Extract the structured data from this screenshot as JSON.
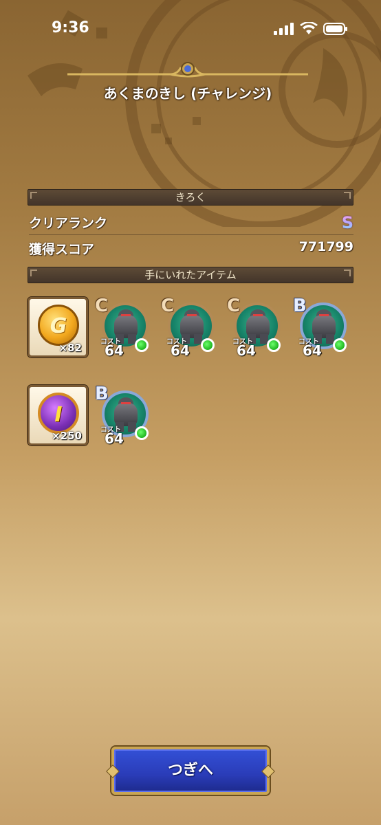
{
  "status_bar": {
    "time": "9:36"
  },
  "header": {
    "title": "あくまのきし (チャレンジ)"
  },
  "record": {
    "section_label": "きろく",
    "clear_rank_label": "クリアランク",
    "clear_rank_value": "S",
    "score_label": "獲得スコア",
    "score_value": "771799"
  },
  "items": {
    "section_label": "手にいれたアイテム",
    "gold": {
      "letter": "G",
      "count": "×82",
      "icon": "gold-coin-icon"
    },
    "ticket": {
      "letter": "I",
      "count": "×250",
      "icon": "item-coin-icon"
    },
    "monsters": [
      {
        "rank": "C",
        "cost_label": "コスト",
        "cost": "64"
      },
      {
        "rank": "C",
        "cost_label": "コスト",
        "cost": "64"
      },
      {
        "rank": "C",
        "cost_label": "コスト",
        "cost": "64"
      },
      {
        "rank": "B",
        "cost_label": "コスト",
        "cost": "64"
      },
      {
        "rank": "B",
        "cost_label": "コスト",
        "cost": "64"
      }
    ]
  },
  "footer": {
    "next_label": "つぎへ"
  },
  "colors": {
    "button_blue": "#2a3cb8",
    "button_frame": "#c9a553",
    "panel_dark": "#43352a"
  }
}
